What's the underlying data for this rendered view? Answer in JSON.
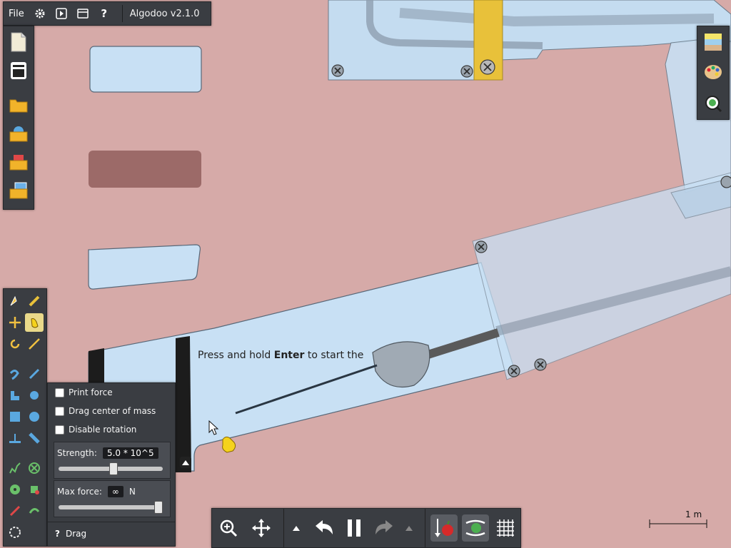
{
  "menubar": {
    "file_label": "File",
    "app_title": "Algodoo v2.1.0",
    "icons": [
      "settings-icon",
      "play-scene-icon",
      "window-icon",
      "help-icon"
    ]
  },
  "left_toolbar": {
    "items": [
      {
        "name": "new-scene",
        "icon": "new-document-icon"
      },
      {
        "name": "toolbox",
        "icon": "toolbox-icon"
      },
      {
        "name": "open-scene",
        "icon": "folder-open-icon"
      },
      {
        "name": "algobox",
        "icon": "algobox-folder-icon"
      },
      {
        "name": "open-phunlet",
        "icon": "phunlet-folder-icon"
      },
      {
        "name": "open-image",
        "icon": "image-folder-icon"
      }
    ]
  },
  "right_toolbar": {
    "items": [
      {
        "name": "background",
        "icon": "background-icon"
      },
      {
        "name": "palette",
        "icon": "palette-icon"
      },
      {
        "name": "zoom-to-selection",
        "icon": "zoom-fit-icon"
      }
    ]
  },
  "tools": {
    "active": "drag",
    "items": [
      "sketch-tool",
      "pen-tool",
      "move-tool",
      "drag-tool",
      "rotate-tool",
      "scale-tool",
      "rope-tool",
      "knife-tool",
      "polygon-tool",
      "gear-tool",
      "box-tool",
      "circle-tool",
      "plane-tool",
      "chain-tool",
      "spring-tool",
      "fixate-tool",
      "axle-tool",
      "tracer-tool",
      "laser-tool",
      "thruster-tool",
      "brush-tool"
    ]
  },
  "drag_options": {
    "print_force": "Print force",
    "drag_center_of_mass": "Drag center of mass",
    "disable_rotation": "Disable rotation",
    "strength_label": "Strength:",
    "strength_value": "5.0 * 10^5",
    "strength_level": 0.53,
    "max_force_label": "Max force:",
    "max_force_value": "∞",
    "max_force_unit": "N",
    "max_force_level": 1.0,
    "help_glyph": "?",
    "tool_name": "Drag"
  },
  "bottom_bar": {
    "buttons": [
      "zoom",
      "pan",
      "speed-up",
      "undo",
      "pause",
      "redo",
      "speed-down",
      "gravity",
      "air-friction",
      "grid"
    ]
  },
  "scene": {
    "hint_prefix": "Press and hold ",
    "hint_key": "Enter",
    "hint_suffix": " to start the"
  },
  "scale_label": "1 m",
  "colors": {
    "background": "#d6aaa8",
    "panel": "#3a3d42",
    "ice": "#c8e0f4",
    "accent_yellow": "#e8c13a",
    "active_tool": "#e9d98a"
  }
}
